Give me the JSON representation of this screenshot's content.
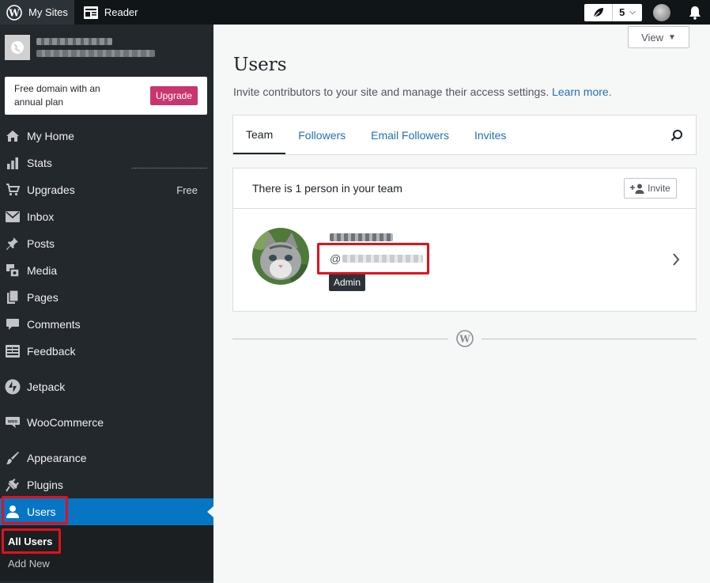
{
  "topbar": {
    "my_sites_label": "My Sites",
    "reader_label": "Reader",
    "streak_count": "5"
  },
  "sidebar": {
    "upgrade_card": {
      "text": "Free domain with an annual plan",
      "button_label": "Upgrade"
    },
    "items": [
      {
        "label": "My Home",
        "icon": "home-icon"
      },
      {
        "label": "Stats",
        "icon": "stats-icon"
      },
      {
        "label": "Upgrades",
        "icon": "cart-icon",
        "badge": "Free"
      },
      {
        "label": "Inbox",
        "icon": "mail-icon"
      },
      {
        "label": "Posts",
        "icon": "pin-icon"
      },
      {
        "label": "Media",
        "icon": "media-icon"
      },
      {
        "label": "Pages",
        "icon": "pages-icon"
      },
      {
        "label": "Comments",
        "icon": "comment-icon"
      },
      {
        "label": "Feedback",
        "icon": "feedback-icon"
      },
      {
        "label": "Jetpack",
        "icon": "jetpack-icon"
      },
      {
        "label": "WooCommerce",
        "icon": "woo-icon"
      },
      {
        "label": "Appearance",
        "icon": "brush-icon"
      },
      {
        "label": "Plugins",
        "icon": "plug-icon"
      },
      {
        "label": "Users",
        "icon": "user-icon"
      }
    ],
    "submenu": {
      "all_users": "All Users",
      "add_new": "Add New"
    }
  },
  "main": {
    "view_label": "View",
    "title": "Users",
    "subtitle": "Invite contributors to your site and manage their access settings.",
    "learn_more": "Learn more.",
    "tabs": [
      {
        "label": "Team"
      },
      {
        "label": "Followers"
      },
      {
        "label": "Email Followers"
      },
      {
        "label": "Invites"
      }
    ],
    "team": {
      "summary": "There is 1 person in your team",
      "invite_label": "Invite",
      "user": {
        "handle_prefix": "@",
        "role": "Admin"
      }
    }
  },
  "colors": {
    "accent": "#2271b1",
    "active_menu": "#0675c4",
    "upgrade_button": "#c9356e",
    "highlight_box": "#e3101c"
  }
}
